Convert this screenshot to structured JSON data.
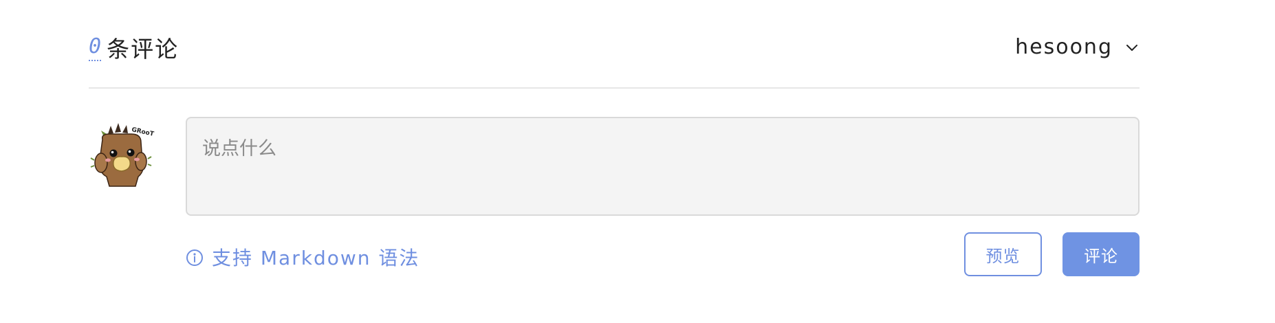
{
  "header": {
    "comment_count": "0",
    "comment_count_label": "条评论",
    "user_name": "hesoong"
  },
  "composer": {
    "placeholder": "说点什么",
    "value": "",
    "markdown_hint": "支持 Markdown 语法",
    "preview_button_label": "预览",
    "submit_button_label": "评论"
  },
  "icons": {
    "user_menu_chevron": "chevron-down-icon",
    "hint_icon": "info-icon",
    "avatar": "groot-avatar"
  },
  "colors": {
    "accent": "#6f8fe0",
    "submit_bg": "#6f93e3",
    "input_bg": "#f4f4f4",
    "divider": "#e6e6e6",
    "text": "#222222",
    "placeholder": "#8a8a8a"
  }
}
